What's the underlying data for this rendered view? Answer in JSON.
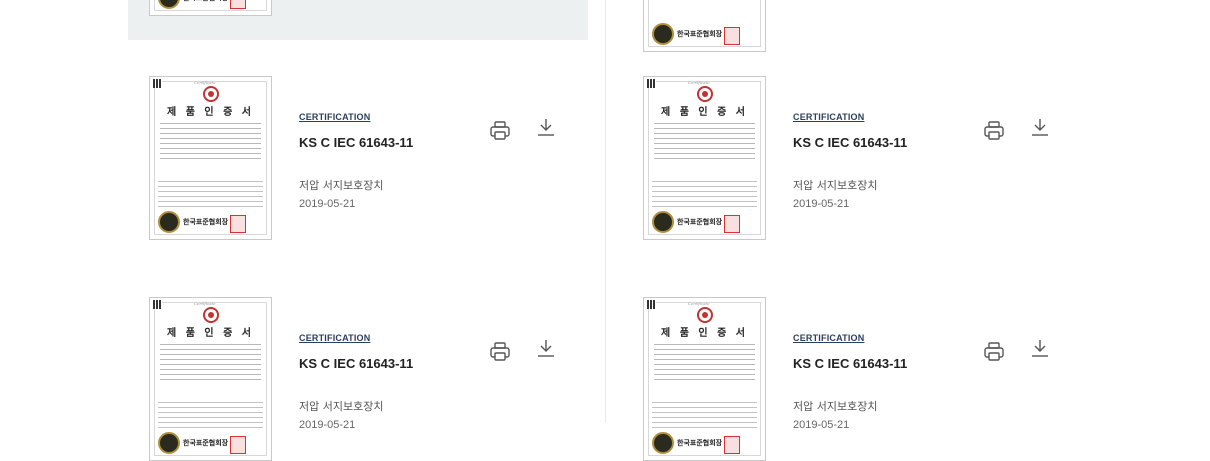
{
  "cards": [
    {
      "category": "CERTIFICATION",
      "title": "KS C IEC 61643-11",
      "subtitle": "저압 서지보호장치",
      "date": "2019-05-21",
      "thumb_heading": "제 품 인 증 서",
      "thumb_issuer": "한국표준협회장",
      "thumb_script": "Certificate"
    },
    {
      "category": "CERTIFICATION",
      "title": "KS C IEC 61643-11",
      "subtitle": "저압 서지보호장치",
      "date": "2019-05-21",
      "thumb_heading": "제 품 인 증 서",
      "thumb_issuer": "한국표준협회장",
      "thumb_script": "Certificate"
    },
    {
      "category": "CERTIFICATION",
      "title": "KS C IEC 61643-11",
      "subtitle": "저압 서지보호장치",
      "date": "2019-05-21",
      "thumb_heading": "제 품 인 증 서",
      "thumb_issuer": "한국표준협회장",
      "thumb_script": "Certificate"
    },
    {
      "category": "CERTIFICATION",
      "title": "KS C IEC 61643-11",
      "subtitle": "저압 서지보호장치",
      "date": "2019-05-21",
      "thumb_heading": "제 품 인 증 서",
      "thumb_issuer": "한국표준협회장",
      "thumb_script": "Certificate"
    }
  ],
  "top_partial": {
    "thumb_issuer": "한국표준협회장"
  },
  "icons": {
    "print": "printer-icon",
    "download": "download-icon"
  },
  "colors": {
    "highlight_bg": "#ecf0f1",
    "category_text": "#2a3f5c",
    "title_text": "#222222",
    "icon_stroke": "#555555"
  }
}
